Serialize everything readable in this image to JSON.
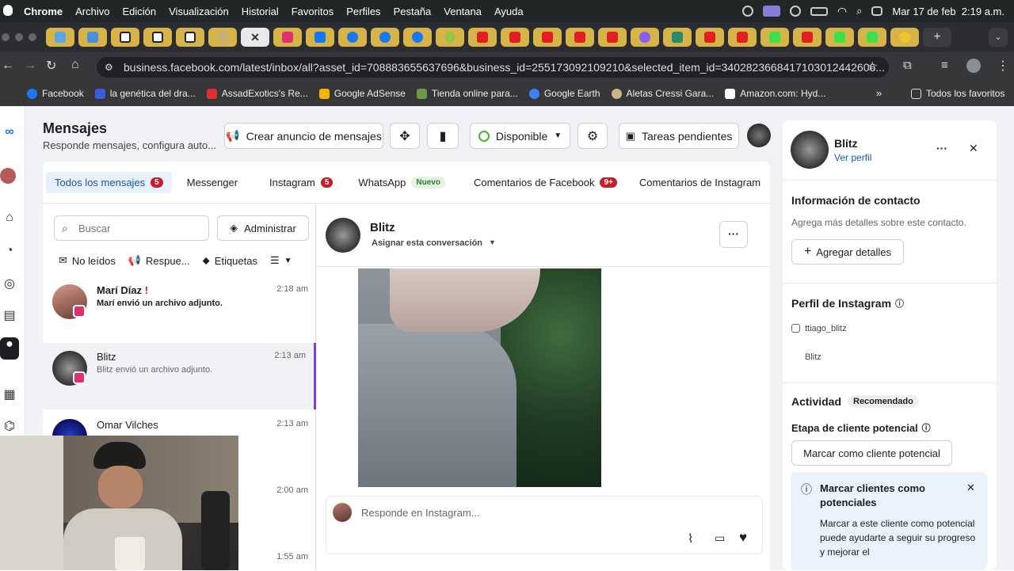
{
  "menubar": {
    "app": "Chrome",
    "items": [
      "Archivo",
      "Edición",
      "Visualización",
      "Historial",
      "Favoritos",
      "Perfiles",
      "Pestaña",
      "Ventana",
      "Ayuda"
    ],
    "datetime": "Mar 17 de feb  2:19 a.m."
  },
  "browser": {
    "url": "business.facebook.com/latest/inbox/all?asset_id=708883655637696&business_id=255173092109210&selected_item_id=3402823668417103012442606...",
    "bookmarks": [
      "Facebook",
      "la genética del dra...",
      "AssadExotics's Re...",
      "Google AdSense",
      "Tienda online para...",
      "Google Earth",
      "Aletas Cressi Gara...",
      "Amazon.com: Hyd..."
    ],
    "bookmarks_folder": "Todos los favoritos"
  },
  "header": {
    "title": "Mensajes",
    "subtitle": "Responde mensajes, configura auto...",
    "create_ad": "Crear anuncio de mensajes",
    "status": "Disponible",
    "pending": "Tareas pendientes"
  },
  "tabs": [
    {
      "label": "Todos los mensajes",
      "badge": "5"
    },
    {
      "label": "Messenger",
      "badge": ""
    },
    {
      "label": "Instagram",
      "badge": "5"
    },
    {
      "label": "WhatsApp",
      "badge": "Nuevo"
    },
    {
      "label": "Comentarios de Facebook",
      "badge": "9+"
    },
    {
      "label": "Comentarios de Instagram",
      "badge": ""
    }
  ],
  "list": {
    "search_placeholder": "Buscar",
    "admin": "Administrar",
    "filters": [
      "No leídos",
      "Respue...",
      "Etiquetas"
    ],
    "conversations": [
      {
        "name": "Marí Díaz",
        "preview": "Marí envió un archivo adjunto.",
        "time": "2:18 am"
      },
      {
        "name": "Blitz",
        "preview": "Blitz envió un archivo adjunto.",
        "time": "2:13 am"
      },
      {
        "name": "Omar Vilches",
        "preview": "",
        "time": "2:13 am"
      },
      {
        "name": "",
        "preview": "",
        "time": "2:00 am"
      },
      {
        "name": "",
        "preview": "",
        "time": "1:55 am"
      }
    ]
  },
  "chat": {
    "name": "Blitz",
    "assign": "Asignar esta conversación",
    "composer_placeholder": "Responde en Instagram..."
  },
  "contact": {
    "name": "Blitz",
    "view_profile": "Ver perfil",
    "info_title": "Información de contacto",
    "info_desc": "Agrega más detalles sobre este contacto.",
    "add_details": "Agregar detalles",
    "ig_title": "Perfil de Instagram",
    "ig_handle": "ttiago_blitz",
    "ig_name": "Blitz",
    "activity_title": "Actividad",
    "activity_badge": "Recomendado",
    "lead_stage": "Etapa de cliente potencial",
    "mark_lead": "Marcar como cliente potencial",
    "tip_title": "Marcar clientes como potenciales",
    "tip_body": "Marcar a este cliente como potencial puede ayudarte a seguir su progreso y mejorar el"
  },
  "colors": {
    "accent": "#1a56b0",
    "badge": "#c41d2c",
    "selected_bar": "#7a3fd6"
  }
}
